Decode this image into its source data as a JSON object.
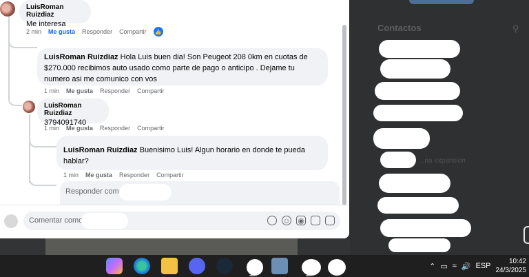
{
  "contacts_panel": {
    "title": "Contactos",
    "ghost_text": "...na expansion"
  },
  "thread": {
    "top_comment": {
      "author": "LuisRoman Ruizdiaz",
      "text": "Me interesa",
      "time": "2 min",
      "like_label": "Me gusta",
      "reply_label": "Responder",
      "share_label": "Compartir"
    },
    "reply_1": {
      "author": "LuisRoman Ruizdiaz",
      "text": "Hola Luis buen dia! Son Peugeot 208 0km en cuotas de $270.000 recibimos auto usado como parte de pago o anticipo . Dejame tu numero asi me comunico con vos",
      "time": "1 min",
      "like_label": "Me gusta",
      "reply_label": "Responder",
      "share_label": "Compartir"
    },
    "reply_2": {
      "author": "LuisRoman Ruizdiaz",
      "text": "3794091740",
      "time": "1 min",
      "like_label": "Me gusta",
      "reply_label": "Responder",
      "share_label": "Compartir"
    },
    "reply_3": {
      "author": "LuisRoman Ruizdiaz",
      "text": "Buenisimo Luis! Algun horario en donde te pueda hablar?",
      "time": "1 min",
      "like_label": "Me gusta",
      "reply_label": "Responder",
      "share_label": "Compartir"
    },
    "reply_input_placeholder": "Responder como",
    "comment_input_placeholder": "Comentar como"
  },
  "taskbar": {
    "language": "ESP",
    "time": "10:42",
    "date": "24/3/2025"
  },
  "colors": {
    "accent": "#0866ff",
    "like_badge": "#1877f2",
    "bubble": "#f0f2f5"
  }
}
